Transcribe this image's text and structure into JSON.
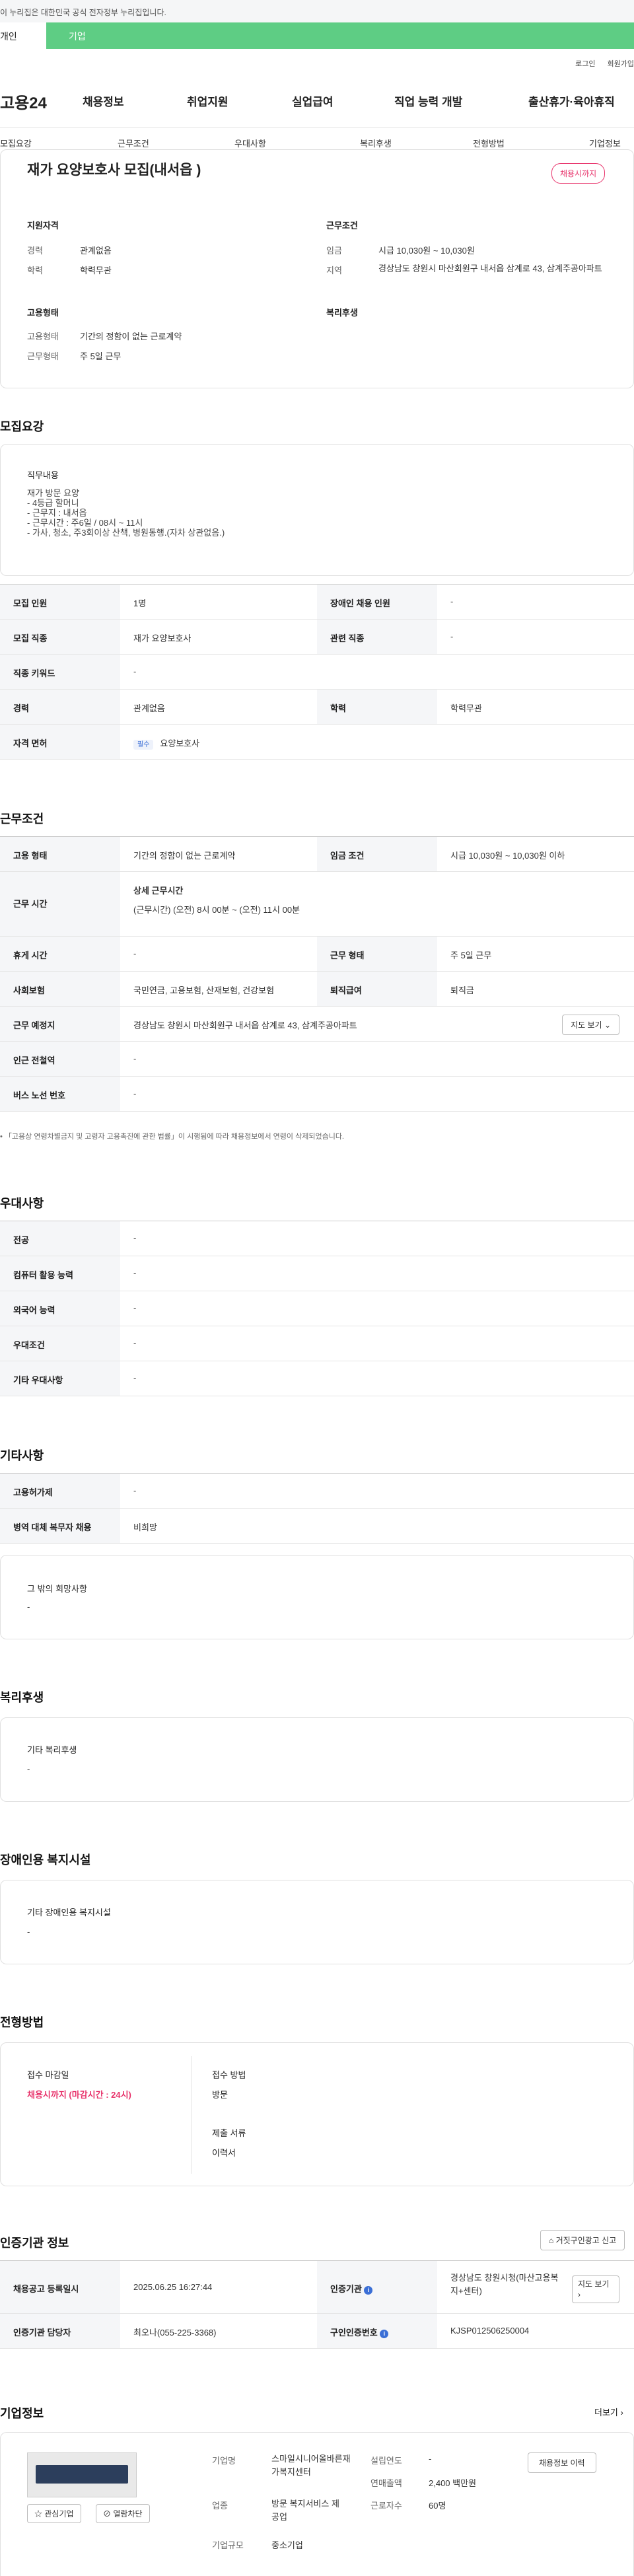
{
  "gov_banner": "이 누리집은 대한민국 공식 전자정부 누리집입니다.",
  "top_tabs": [
    "개인",
    "기업"
  ],
  "util": [
    "로그인",
    "회원가입"
  ],
  "logo": "고용24",
  "gnb": [
    "채용정보",
    "취업지원",
    "실업급여",
    "직업 능력 개발",
    "출산휴가·육아휴직"
  ],
  "subnav": [
    "모집요강",
    "근무조건",
    "우대사항",
    "복리후생",
    "전형방법",
    "기업정보"
  ],
  "title": "재가 요양보호사 모집(내서읍 )",
  "status_badge": "채용시까지",
  "summary": {
    "qual_title": "지원자격",
    "cond_title": "근무조건",
    "type_title": "고용형태",
    "welfare_title": "복리후생",
    "career_l": "경력",
    "career_v": "관계없음",
    "edu_l": "학력",
    "edu_v": "학력무관",
    "wage_l": "임금",
    "wage_v": "시급 10,030원 ~ 10,030원",
    "region_l": "지역",
    "region_v": "경상남도 창원시 마산회원구 내서읍 삼계로 43, 삼계주공아파트",
    "etype_l": "고용형태",
    "etype_v": "기간의 정함이 없는 근로계약",
    "wtype_l": "근무형태",
    "wtype_v": "주 5일 근무"
  },
  "recruit": {
    "heading": "모집요강",
    "duty_title": "직무내용",
    "duty_lines": [
      "재가 방문 요양",
      "- 4등급 할머니",
      "- 근무지 : 내서읍",
      "- 근무시간 : 주6일 / 08시 ~ 11시",
      "- 가사, 청소, 주3회이상 산책, 병원동행.(자차 상관없음.)"
    ],
    "rows": [
      {
        "l1": "모집 인원",
        "v1": "1명",
        "l2": "장애인 채용 인원",
        "v2": "-"
      },
      {
        "l1": "모집 직종",
        "v1": "재가 요양보호사",
        "l2": "관련 직종",
        "v2": "-"
      },
      {
        "l1": "직종 키워드",
        "v1": "-"
      },
      {
        "l1": "경력",
        "v1": "관계없음",
        "l2": "학력",
        "v2": "학력무관"
      },
      {
        "l1": "자격 면허",
        "tag": "필수",
        "v1": "요양보호사"
      }
    ]
  },
  "work": {
    "heading": "근무조건",
    "etype_l": "고용 형태",
    "etype_v": "기간의 정함이 없는 근로계약",
    "wage_l": "임금 조건",
    "wage_v": "시급 10,030원 ~ 10,030원 이하",
    "hours_l": "근무 시간",
    "hours_t": "상세 근무시간",
    "hours_v": "(근무시간) (오전) 8시 00분 ~ (오전) 11시 00분",
    "off_l": "휴게 시간",
    "off_v": "-",
    "form_l": "근무 형태",
    "form_v": "주 5일 근무",
    "ins_l": "사회보험",
    "ins_v": "국민연금, 고용보험, 산재보험, 건강보험",
    "ret_l": "퇴직급여",
    "ret_v": "퇴직금",
    "place_l": "근무 예정지",
    "place_v": "경상남도 창원시 마산회원구 내서읍 삼계로 43, 삼계주공아파트",
    "map_btn": "지도 보기",
    "subway_l": "인근 전철역",
    "subway_v": "-",
    "bus_l": "버스 노선 번호",
    "bus_v": "-",
    "note": "「고용상 연령차별금지 및 고령자 고용촉진에 관한 법률」이 시행됨에 따라 채용정보에서 연령이 삭제되었습니다."
  },
  "pref": {
    "heading": "우대사항",
    "rows": [
      [
        "전공",
        "-"
      ],
      [
        "컴퓨터 활용 능력",
        "-"
      ],
      [
        "외국어 능력",
        "-"
      ],
      [
        "우대조건",
        "-"
      ],
      [
        "기타 우대사항",
        "-"
      ]
    ]
  },
  "etc": {
    "heading": "기타사항",
    "rows": [
      [
        "고용허가제",
        "-"
      ],
      [
        "병역 대체 복무자 채용",
        "비희망"
      ]
    ],
    "hope_t": "그 밖의 희망사항",
    "hope_v": "-"
  },
  "welfare": {
    "heading": "복리후생",
    "t": "기타 복리후생",
    "v": "-"
  },
  "disabled": {
    "heading": "장애인용 복지시설",
    "t": "기타 장애인용 복지시설",
    "v": "-"
  },
  "process": {
    "heading": "전형방법",
    "deadline_t": "접수 마감일",
    "deadline_v": "채용시까지 (마감시간 : 24시)",
    "method_t": "접수 방법",
    "method_v": "방문",
    "docs_t": "제출 서류",
    "docs_v": "이력서"
  },
  "cert": {
    "heading": "인증기관 정보",
    "report_btn": "거짓구인광고 신고",
    "reg_l": "채용공고 등록일시",
    "reg_v": "2025.06.25 16:27:44",
    "org_l": "인증기관",
    "org_v": "경상남도 창원시청(마산고용복지+센터)",
    "map_btn": "지도 보기",
    "mgr_l": "인증기관 담당자",
    "mgr_v": "최오나(055-225-3368)",
    "num_l": "구인인증번호",
    "num_v": "KJSP012506250004"
  },
  "company": {
    "heading": "기업정보",
    "more": "더보기",
    "fav_btn": "관심기업",
    "block_btn": "열람차단",
    "name_l": "기업명",
    "name_v": "스마일시니어올바른재가복지센터",
    "ind_l": "업종",
    "ind_v": "방문 복지서비스 제공업",
    "size_l": "기업규모",
    "size_v": "중소기업",
    "year_l": "설립연도",
    "year_v": "-",
    "rev_l": "연매출액",
    "rev_v": "2,400 백만원",
    "emp_l": "근로자수",
    "emp_v": "60명",
    "jobs_btn": "채용정보 이력"
  },
  "colors": {
    "green": "#5ecd84",
    "pink": "#e8346c",
    "blue": "#3b6fd6"
  }
}
